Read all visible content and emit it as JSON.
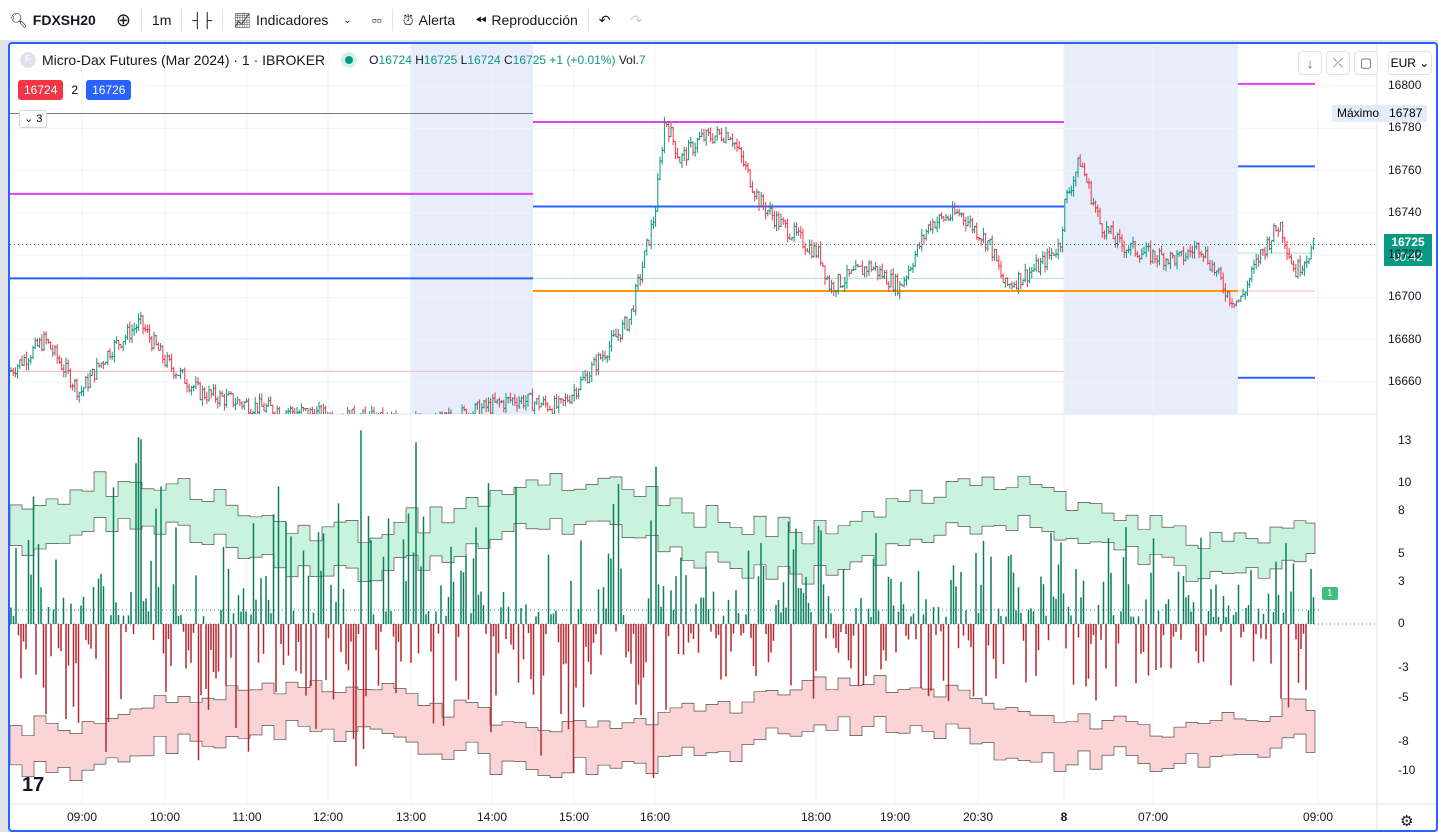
{
  "toolbar": {
    "symbol": "FDXSH20",
    "interval": "1m",
    "indicators": "Indicadores",
    "alert": "Alerta",
    "replay": "Reproducción"
  },
  "legend": {
    "title": "Micro-Dax Futures (Mar 2024) · 1 · IBROKER",
    "o_label": "O",
    "o": "16724",
    "h_label": "H",
    "h": "16725",
    "l_label": "L",
    "l": "16724",
    "c_label": "C",
    "c": "16725",
    "change": "+1 (+0.01%)",
    "vol_label": "Vol.",
    "vol": "7"
  },
  "orders": {
    "bid": "16724",
    "spread": "2",
    "ask": "16726",
    "collapse": "3"
  },
  "currency": "EUR",
  "price_axis": {
    "ticks": [
      "16800",
      "16780",
      "16760",
      "16740",
      "16720",
      "16700",
      "16680",
      "16660"
    ],
    "max_label": "Máximo",
    "max_value": "16787",
    "last_price": "16725",
    "countdown": "00:42"
  },
  "osc_axis": {
    "ticks": [
      "13",
      "10",
      "8",
      "5",
      "3",
      "0",
      "-3",
      "-5",
      "-8",
      "-10"
    ],
    "badge": "1"
  },
  "time_axis": [
    "09:00",
    "10:00",
    "11:00",
    "12:00",
    "13:00",
    "14:00",
    "15:00",
    "16:00",
    "18:00",
    "19:00",
    "20:30",
    "8",
    "07:00",
    "09:00"
  ],
  "colors": {
    "up": "#089981",
    "down": "#f23645",
    "blue": "#2962ff",
    "magenta": "#e040fb",
    "orange": "#ff9800"
  },
  "price_path": [
    [
      0,
      16665
    ],
    [
      35,
      16680
    ],
    [
      70,
      16655
    ],
    [
      100,
      16675
    ],
    [
      130,
      16688
    ],
    [
      155,
      16670
    ],
    [
      190,
      16655
    ],
    [
      250,
      16648
    ],
    [
      320,
      16644
    ],
    [
      420,
      16640
    ],
    [
      505,
      16652
    ],
    [
      550,
      16648
    ],
    [
      580,
      16665
    ],
    [
      620,
      16690
    ],
    [
      645,
      16740
    ],
    [
      655,
      16785
    ],
    [
      670,
      16765
    ],
    [
      690,
      16775
    ],
    [
      720,
      16778
    ],
    [
      750,
      16745
    ],
    [
      770,
      16735
    ],
    [
      810,
      16720
    ],
    [
      820,
      16705
    ],
    [
      860,
      16715
    ],
    [
      890,
      16705
    ],
    [
      920,
      16735
    ],
    [
      950,
      16740
    ],
    [
      980,
      16725
    ],
    [
      995,
      16705
    ],
    [
      1030,
      16715
    ],
    [
      1050,
      16725
    ],
    [
      1055,
      16745
    ],
    [
      1070,
      16765
    ],
    [
      1090,
      16735
    ],
    [
      1110,
      16725
    ],
    [
      1140,
      16720
    ],
    [
      1170,
      16718
    ],
    [
      1190,
      16725
    ],
    [
      1220,
      16700
    ],
    [
      1230,
      16698
    ],
    [
      1250,
      16720
    ],
    [
      1270,
      16735
    ],
    [
      1285,
      16712
    ],
    [
      1305,
      16725
    ]
  ]
}
